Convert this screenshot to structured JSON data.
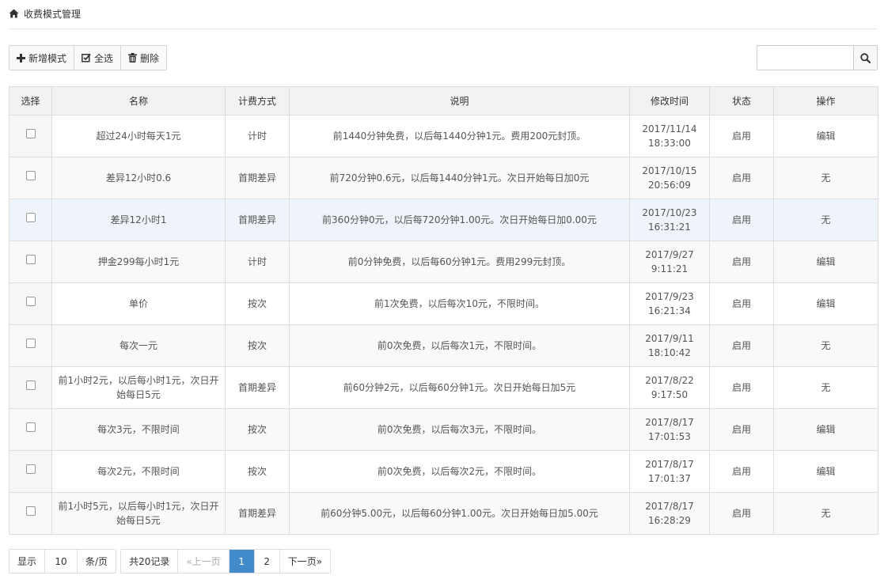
{
  "breadcrumb": {
    "title": "收费模式管理",
    "icon": "home-icon"
  },
  "toolbar": {
    "add_label": "新增模式",
    "select_all_label": "全选",
    "delete_label": "删除"
  },
  "search": {
    "value": "",
    "placeholder": ""
  },
  "table": {
    "headers": [
      "选择",
      "名称",
      "计费方式",
      "说明",
      "修改时间",
      "状态",
      "操作"
    ],
    "rows": [
      {
        "name": "超过24小时每天1元",
        "mode": "计时",
        "desc": "前1440分钟免费，以后每1440分钟1元。费用200元封顶。",
        "date": "2017/11/14",
        "time": "18:33:00",
        "status": "启用",
        "action": "编辑"
      },
      {
        "name": "差异12小时0.6",
        "mode": "首期差异",
        "desc": "前720分钟0.6元，以后每1440分钟1元。次日开始每日加0元",
        "date": "2017/10/15",
        "time": "20:56:09",
        "status": "启用",
        "action": "无"
      },
      {
        "name": "差异12小时1",
        "mode": "首期差异",
        "desc": "前360分钟0元，以后每720分钟1.00元。次日开始每日加0.00元",
        "date": "2017/10/23",
        "time": "16:31:21",
        "status": "启用",
        "action": "无"
      },
      {
        "name": "押金299每小时1元",
        "mode": "计时",
        "desc": "前0分钟免费，以后每60分钟1元。费用299元封顶。",
        "date": "2017/9/27",
        "time": "9:11:21",
        "status": "启用",
        "action": "编辑"
      },
      {
        "name": "单价",
        "mode": "按次",
        "desc": "前1次免费，以后每次10元，不限时间。",
        "date": "2017/9/23",
        "time": "16:21:34",
        "status": "启用",
        "action": "编辑"
      },
      {
        "name": "每次一元",
        "mode": "按次",
        "desc": "前0次免费，以后每次1元，不限时间。",
        "date": "2017/9/11",
        "time": "18:10:42",
        "status": "启用",
        "action": "无"
      },
      {
        "name": "前1小时2元，以后每小时1元，次日开始每日5元",
        "mode": "首期差异",
        "desc": "前60分钟2元，以后每60分钟1元。次日开始每日加5元",
        "date": "2017/8/22",
        "time": "9:17:50",
        "status": "启用",
        "action": "无"
      },
      {
        "name": "每次3元，不限时间",
        "mode": "按次",
        "desc": "前0次免费，以后每次3元，不限时间。",
        "date": "2017/8/17",
        "time": "17:01:53",
        "status": "启用",
        "action": "编辑"
      },
      {
        "name": "每次2元，不限时间",
        "mode": "按次",
        "desc": "前0次免费，以后每次2元，不限时间。",
        "date": "2017/8/17",
        "time": "17:01:37",
        "status": "启用",
        "action": "编辑"
      },
      {
        "name": "前1小时5元，以后每小时1元，次日开始每日5元",
        "mode": "首期差异",
        "desc": "前60分钟5.00元，以后每60分钟1.00元。次日开始每日加5.00元",
        "date": "2017/8/17",
        "time": "16:28:29",
        "status": "启用",
        "action": "无"
      }
    ]
  },
  "pagination": {
    "show_label": "显示",
    "page_size": "10",
    "per_page_label": "条/页",
    "total_label": "共20记录",
    "prev_label": "«上一页",
    "pages": [
      "1",
      "2"
    ],
    "current_page": "1",
    "next_label": "下一页»"
  },
  "colors": {
    "mode_timed": "#f0a30a",
    "mode_diff": "#3cb371",
    "mode_per_use": "#5bb2dd",
    "status_enabled": "#1a8a1a",
    "edit_link": "#2f6fb0",
    "active_page": "#428bca"
  }
}
